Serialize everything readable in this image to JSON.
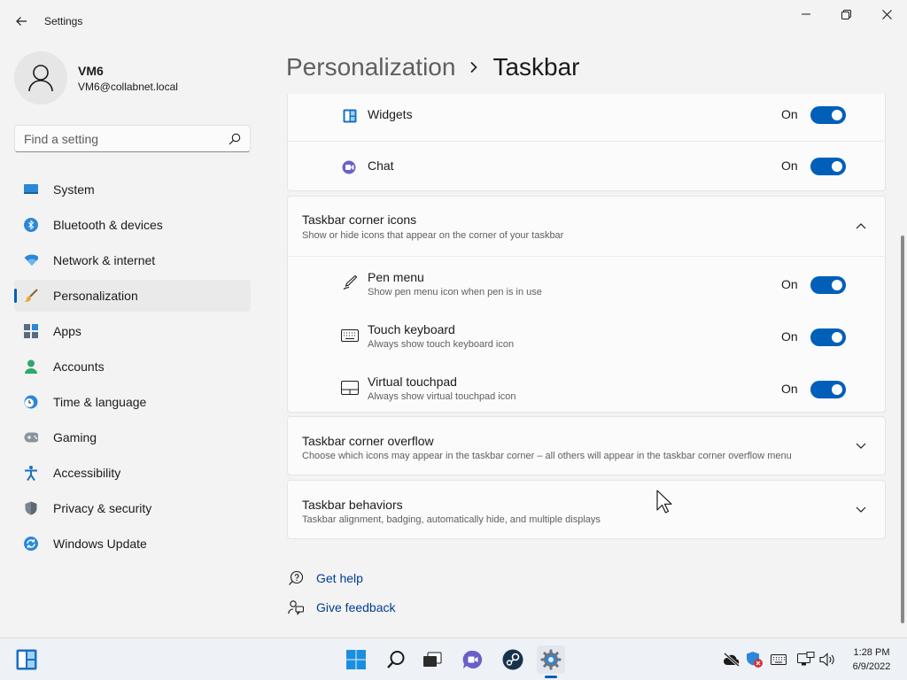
{
  "window": {
    "app_title": "Settings"
  },
  "profile": {
    "name": "VM6",
    "email": "VM6@collabnet.local"
  },
  "search": {
    "placeholder": "Find a setting"
  },
  "nav": {
    "items": [
      {
        "label": "System",
        "icon": "system-icon",
        "active": false
      },
      {
        "label": "Bluetooth & devices",
        "icon": "bluetooth-icon",
        "active": false
      },
      {
        "label": "Network & internet",
        "icon": "wifi-icon",
        "active": false
      },
      {
        "label": "Personalization",
        "icon": "brush-icon",
        "active": true
      },
      {
        "label": "Apps",
        "icon": "apps-icon",
        "active": false
      },
      {
        "label": "Accounts",
        "icon": "accounts-icon",
        "active": false
      },
      {
        "label": "Time & language",
        "icon": "clock-globe-icon",
        "active": false
      },
      {
        "label": "Gaming",
        "icon": "gamepad-icon",
        "active": false
      },
      {
        "label": "Accessibility",
        "icon": "accessibility-icon",
        "active": false
      },
      {
        "label": "Privacy & security",
        "icon": "shield-icon",
        "active": false
      },
      {
        "label": "Windows Update",
        "icon": "update-icon",
        "active": false
      }
    ]
  },
  "header": {
    "parent": "Personalization",
    "current": "Taskbar"
  },
  "taskbar_items": {
    "widgets": {
      "label": "Widgets",
      "state": "On",
      "enabled": true
    },
    "chat": {
      "label": "Chat",
      "state": "On",
      "enabled": true
    }
  },
  "corner_icons": {
    "title": "Taskbar corner icons",
    "subtitle": "Show or hide icons that appear on the corner of your taskbar",
    "expanded": true,
    "items": [
      {
        "title": "Pen menu",
        "subtitle": "Show pen menu icon when pen is in use",
        "state": "On",
        "enabled": true,
        "icon": "pen-icon"
      },
      {
        "title": "Touch keyboard",
        "subtitle": "Always show touch keyboard icon",
        "state": "On",
        "enabled": true,
        "icon": "keyboard-icon"
      },
      {
        "title": "Virtual touchpad",
        "subtitle": "Always show virtual touchpad icon",
        "state": "On",
        "enabled": true,
        "icon": "touchpad-icon"
      }
    ]
  },
  "corner_overflow": {
    "title": "Taskbar corner overflow",
    "subtitle": "Choose which icons may appear in the taskbar corner – all others will appear in the taskbar corner overflow menu",
    "expanded": false
  },
  "behaviors": {
    "title": "Taskbar behaviors",
    "subtitle": "Taskbar alignment, badging, automatically hide, and multiple displays",
    "expanded": false
  },
  "links": {
    "help": "Get help",
    "feedback": "Give feedback"
  },
  "clock": {
    "time": "1:28 PM",
    "date": "6/9/2022"
  },
  "colors": {
    "accent": "#005fb8",
    "link": "#003e92",
    "background": "#f3f3f3",
    "card": "#fbfbfb"
  }
}
